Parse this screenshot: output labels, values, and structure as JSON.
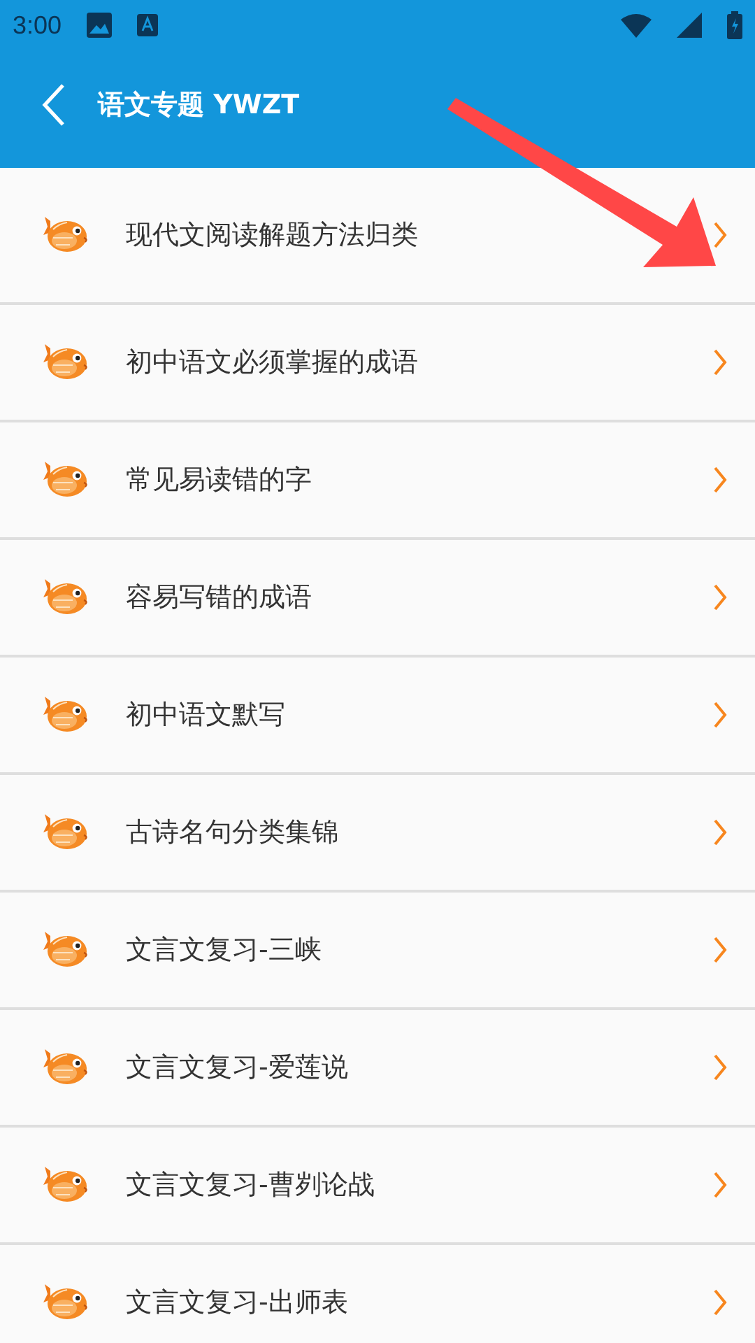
{
  "status_bar": {
    "time": "3:00"
  },
  "header": {
    "title": "语文专题 YWZT"
  },
  "items": [
    {
      "label": "现代文阅读解题方法归类"
    },
    {
      "label": "初中语文必须掌握的成语"
    },
    {
      "label": "常见易读错的字"
    },
    {
      "label": "容易写错的成语"
    },
    {
      "label": "初中语文默写"
    },
    {
      "label": "古诗名句分类集锦"
    },
    {
      "label": "文言文复习-三峡"
    },
    {
      "label": "文言文复习-爱莲说"
    },
    {
      "label": "文言文复习-曹刿论战"
    },
    {
      "label": "文言文复习-出师表"
    }
  ]
}
